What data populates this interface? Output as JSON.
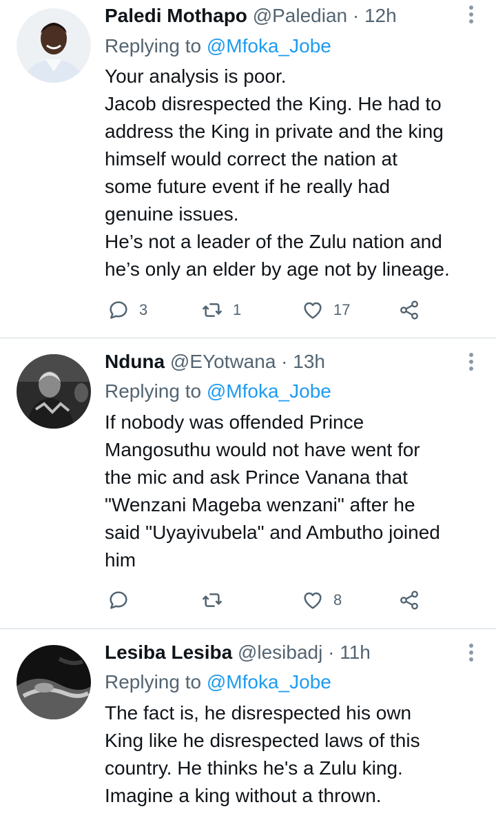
{
  "tweets": [
    {
      "name": "Paledi Mothapo",
      "handle": "@Paledian",
      "time": "12h",
      "replying_label": "Replying to",
      "replying_to": "@Mfoka_Jobe",
      "lines": [
        "Your analysis is poor.",
        "Jacob disrespected the King. He had to",
        "address the King in private and the king",
        "himself would correct the nation at",
        "some future event if he really had",
        "genuine issues.",
        "He’s not a leader of the Zulu nation and",
        "he’s only an elder by age not by lineage."
      ],
      "replies": "3",
      "retweets": "1",
      "likes": "17"
    },
    {
      "name": "Nduna",
      "handle": "@EYotwana",
      "time": "13h",
      "replying_label": "Replying to",
      "replying_to": "@Mfoka_Jobe",
      "lines": [
        "If nobody was offended Prince",
        "Mangosuthu would not have went for",
        "the mic and ask Prince Vanana that",
        "\"Wenzani Mageba wenzani\" after he",
        "said \"Uyayivubela\" and Ambutho joined",
        "him"
      ],
      "replies": "",
      "retweets": "",
      "likes": "8"
    },
    {
      "name": "Lesiba Lesiba",
      "handle": "@lesibadj",
      "time": "11h",
      "replying_label": "Replying to",
      "replying_to": "@Mfoka_Jobe",
      "lines": [
        "The fact is, he disrespected his own",
        "King like he disrespected laws of this",
        "country. He thinks he's a Zulu king.",
        "Imagine a king without a thrown."
      ]
    }
  ],
  "separator": " · ",
  "icons": {
    "reply": "reply-icon",
    "retweet": "retweet-icon",
    "like": "heart-icon",
    "share": "share-icon",
    "more": "more-options-icon"
  },
  "colors": {
    "text": "#0f1419",
    "secondary": "#536471",
    "accent": "#1d9bf0",
    "divider": "#cfd9de"
  }
}
